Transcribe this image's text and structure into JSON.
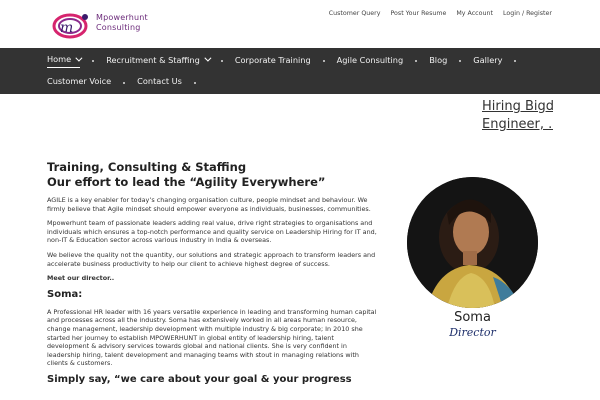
{
  "brand": {
    "name_line1": "Mpowerhunt",
    "name_line2": "Consulting"
  },
  "top_links": [
    "Customer Query",
    "Post Your Resume",
    "My Account",
    "Login / Register"
  ],
  "nav": {
    "row1": [
      {
        "label": "Home",
        "dropdown": true,
        "active": true
      },
      {
        "label": "Recruitment & Staffing",
        "dropdown": true
      },
      {
        "label": "Corporate Training"
      },
      {
        "label": "Agile Consulting"
      },
      {
        "label": "Blog"
      },
      {
        "label": "Gallery"
      }
    ],
    "row2": [
      {
        "label": "Customer Voice"
      },
      {
        "label": "Contact Us"
      }
    ]
  },
  "banner": {
    "scroll_line1": "Hiring Bigda",
    "scroll_line2": "Engineer, .N"
  },
  "main": {
    "title1": "Training, Consulting & Staffing",
    "title2": "Our effort to lead the “Agility Everywhere”",
    "para1": "AGILE is a key enabler for today’s changing organisation culture, people mindset and behaviour. We firmly believe that Agile mindset should empower everyone as individuals, businesses, communities.",
    "para2": "Mpowerhunt team of  passionate leaders adding real value, drive right strategies to organisations and individuals which ensures a top-notch performance and quality service on Leadership Hiring  for IT and, non-IT  & Education sector across various industry in India & overseas.",
    "para3": "We believe the quality not the quantity, our solutions and strategic approach to transform leaders and accelerate business productivity to help our client to achieve highest degree of success.",
    "meet": "Meet our director..",
    "director_heading": "Soma:",
    "director_bio": "A Professional HR leader with 16 years versatile experience in leading and transforming human capital and processes across all the industry. Soma has extensively worked in all areas human resource, change management, leadership development with multiple industry & big corporate; In 2010 she started her journey to establish MPOWERHUNT in global entity of  leadership hiring, talent development & advisory services towards  global and national clients. She is very confident in leadership hiring, talent development  and managing teams with stout in managing relations with clients & customers.",
    "simply_say": "Simply say, “we care about your goal & your progress"
  },
  "profile": {
    "name": "Soma",
    "role": "Director"
  },
  "colors": {
    "nav_bg": "#333333",
    "brand_purple": "#6b2a7a",
    "brand_pink": "#d6246e"
  }
}
